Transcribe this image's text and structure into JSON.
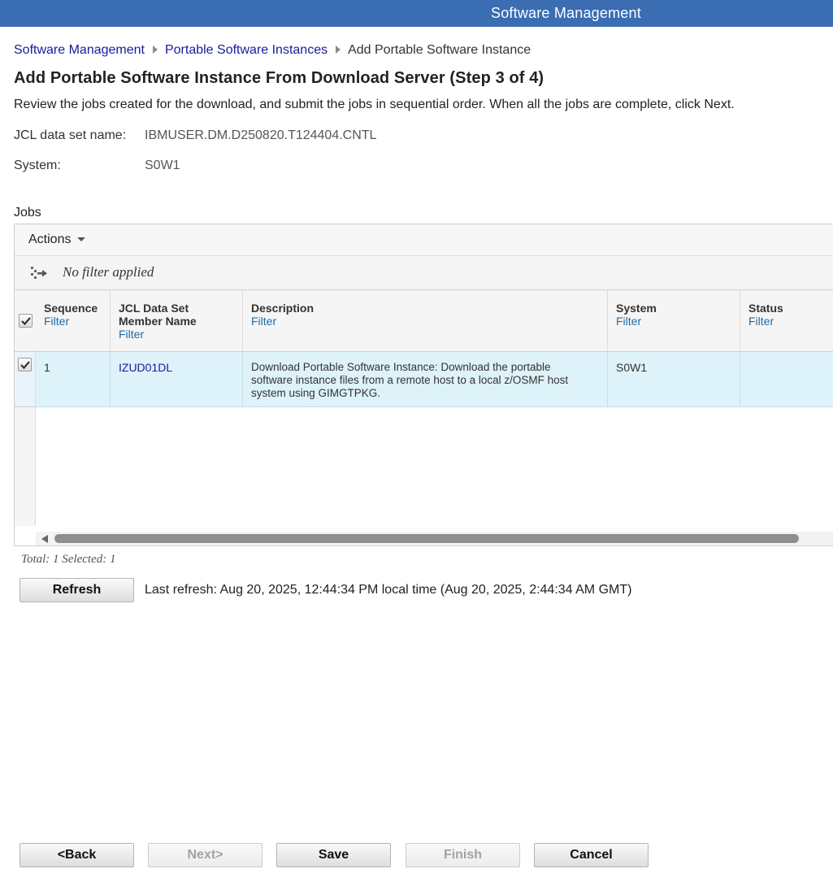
{
  "header": {
    "title": "Software Management"
  },
  "breadcrumb": {
    "items": [
      "Software Management",
      "Portable Software Instances"
    ],
    "current": "Add Portable Software Instance"
  },
  "page": {
    "title": "Add Portable Software Instance From Download Server (Step 3 of 4)",
    "intro": "Review the jobs created for the download, and submit the jobs in sequential order. When all the jobs are complete, click Next."
  },
  "fields": {
    "jcl_label": "JCL data set name:",
    "jcl_value": "IBMUSER.DM.D250820.T124404.CNTL",
    "system_label": "System:",
    "system_value": "S0W1"
  },
  "jobs": {
    "label": "Jobs",
    "actions_label": "Actions",
    "filter_status": "No filter applied",
    "columns": [
      {
        "title": "Sequence",
        "filter": "Filter"
      },
      {
        "title": "JCL Data Set Member Name",
        "filter": "Filter"
      },
      {
        "title": "Description",
        "filter": "Filter"
      },
      {
        "title": "System",
        "filter": "Filter"
      },
      {
        "title": "Status",
        "filter": "Filter"
      }
    ],
    "rows": [
      {
        "selected": true,
        "sequence": "1",
        "member": "IZUD01DL",
        "description": "Download Portable Software Instance:  Download the portable software instance files from a remote host to a local z/OSMF host system using GIMGTPKG.",
        "system": "S0W1",
        "status": ""
      }
    ],
    "totals": "Total: 1 Selected: 1"
  },
  "refresh": {
    "button_label": "Refresh",
    "last_refresh": "Last refresh: Aug 20, 2025, 12:44:34 PM local time (Aug 20, 2025, 2:44:34 AM GMT)"
  },
  "footer": {
    "back": "<Back",
    "next": "Next>",
    "save": "Save",
    "finish": "Finish",
    "cancel": "Cancel"
  },
  "colors": {
    "header_bg": "#3b6db3",
    "link": "#1a1a9c",
    "filter_link": "#1f6aa5",
    "selected_row": "#def2f9"
  }
}
